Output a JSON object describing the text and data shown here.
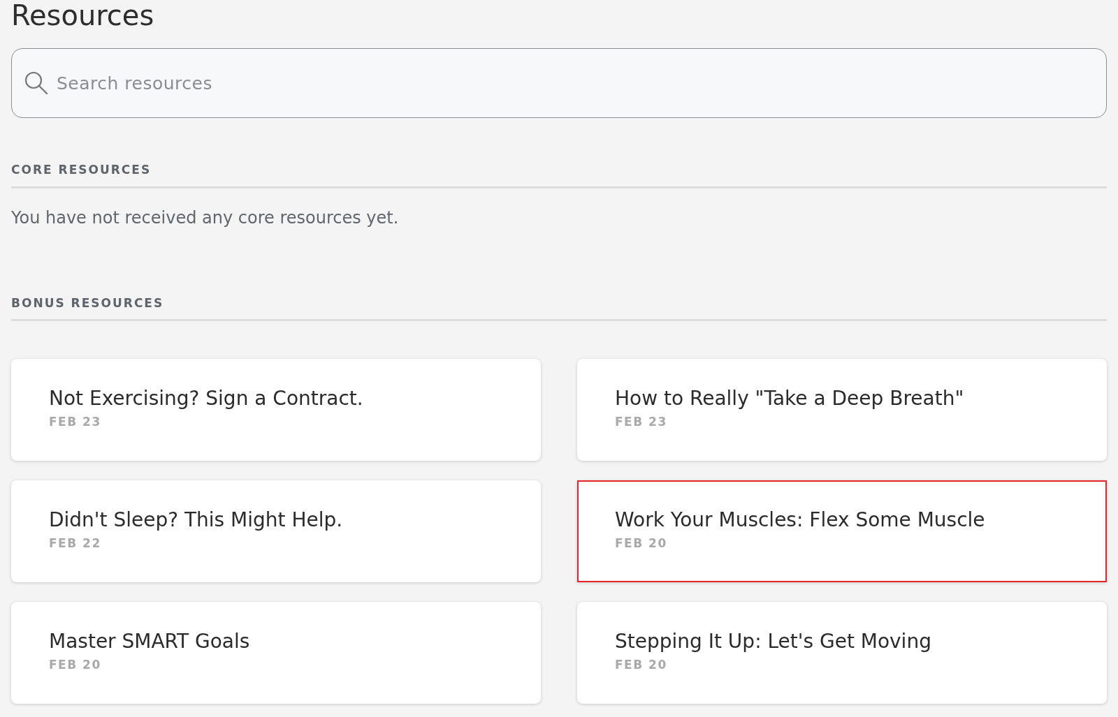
{
  "page": {
    "title": "Resources"
  },
  "search": {
    "placeholder": "Search resources"
  },
  "core": {
    "heading": "CORE RESOURCES",
    "empty_message": "You have not received any core resources yet."
  },
  "bonus": {
    "heading": "BONUS RESOURCES",
    "items": [
      {
        "title": "Not Exercising? Sign a Contract.",
        "date": "FEB 23",
        "selected": false
      },
      {
        "title": "How to Really \"Take a Deep Breath\"",
        "date": "FEB 23",
        "selected": false
      },
      {
        "title": "Didn't Sleep? This Might Help.",
        "date": "FEB 22",
        "selected": false
      },
      {
        "title": "Work Your Muscles: Flex Some Muscle",
        "date": "FEB 20",
        "selected": true
      },
      {
        "title": "Master SMART Goals",
        "date": "FEB 20",
        "selected": false
      },
      {
        "title": "Stepping It Up: Let's Get Moving",
        "date": "FEB 20",
        "selected": false
      }
    ]
  }
}
